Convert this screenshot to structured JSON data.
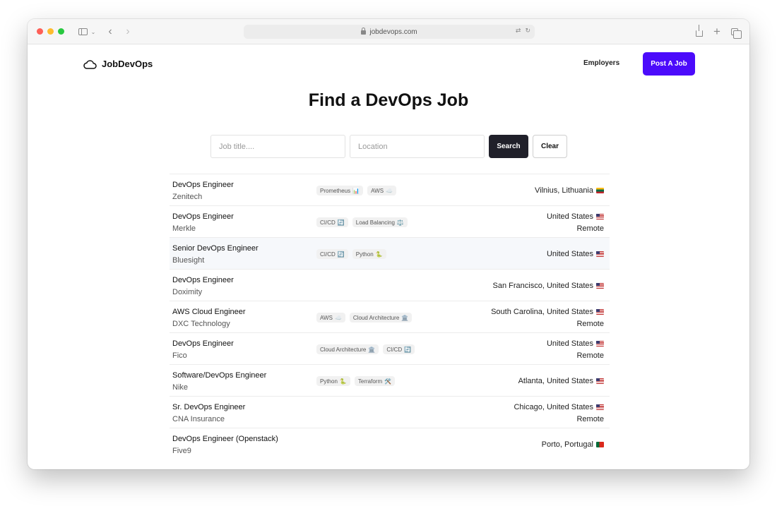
{
  "browser": {
    "url": "jobdevops.com"
  },
  "header": {
    "logo_text": "JobDevOps",
    "employers_label": "Employers",
    "post_job_label": "Post A Job"
  },
  "main": {
    "title": "Find a DevOps Job",
    "search": {
      "title_placeholder": "Job title....",
      "location_placeholder": "Location",
      "search_label": "Search",
      "clear_label": "Clear"
    },
    "jobs": [
      {
        "title": "DevOps Engineer",
        "company": "Zenitech",
        "tags": [
          {
            "label": "Prometheus",
            "icon": "📊"
          },
          {
            "label": "AWS",
            "icon": "☁️"
          }
        ],
        "location": "Vilnius, Lithuania",
        "flag": "lt",
        "remote": ""
      },
      {
        "title": "DevOps Engineer",
        "company": "Merkle",
        "tags": [
          {
            "label": "CI/CD",
            "icon": "🔄"
          },
          {
            "label": "Load Balancing",
            "icon": "⚖️"
          }
        ],
        "location": "United States",
        "flag": "us",
        "remote": "Remote"
      },
      {
        "title": "Senior DevOps Engineer",
        "company": "Bluesight",
        "tags": [
          {
            "label": "CI/CD",
            "icon": "🔄"
          },
          {
            "label": "Python",
            "icon": "🐍"
          }
        ],
        "location": "United States",
        "flag": "us",
        "remote": ""
      },
      {
        "title": "DevOps Engineer",
        "company": "Doximity",
        "tags": [],
        "location": "San Francisco, United States",
        "flag": "us",
        "remote": ""
      },
      {
        "title": "AWS Cloud Engineer",
        "company": "DXC Technology",
        "tags": [
          {
            "label": "AWS",
            "icon": "☁️"
          },
          {
            "label": "Cloud Architecture",
            "icon": "🏛️"
          }
        ],
        "location": "South Carolina, United States",
        "flag": "us",
        "remote": "Remote"
      },
      {
        "title": "DevOps Engineer",
        "company": "Fico",
        "tags": [
          {
            "label": "Cloud Architecture",
            "icon": "🏛️"
          },
          {
            "label": "CI/CD",
            "icon": "🔄"
          }
        ],
        "location": "United States",
        "flag": "us",
        "remote": "Remote"
      },
      {
        "title": "Software/DevOps Engineer",
        "company": "Nike",
        "tags": [
          {
            "label": "Python",
            "icon": "🐍"
          },
          {
            "label": "Terraform",
            "icon": "🛠️"
          }
        ],
        "location": "Atlanta, United States",
        "flag": "us",
        "remote": ""
      },
      {
        "title": "Sr. DevOps Engineer",
        "company": "CNA Insurance",
        "tags": [],
        "location": "Chicago, United States",
        "flag": "us",
        "remote": "Remote"
      },
      {
        "title": "DevOps Engineer (Openstack)",
        "company": "Five9",
        "tags": [],
        "location": "Porto, Portugal",
        "flag": "pt",
        "remote": ""
      }
    ]
  },
  "colors": {
    "accent": "#4b0bfb",
    "dark_button": "#20202a"
  }
}
